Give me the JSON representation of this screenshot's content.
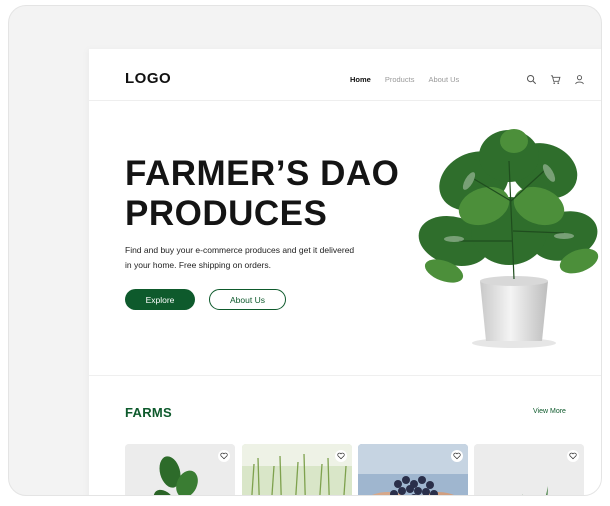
{
  "header": {
    "logo": "LOGO",
    "nav": [
      {
        "label": "Home",
        "active": true
      },
      {
        "label": "Products",
        "active": false
      },
      {
        "label": "About Us",
        "active": false
      }
    ],
    "icons": [
      "search-icon",
      "cart-icon",
      "user-icon"
    ]
  },
  "hero": {
    "title_line1": "FARMER’S DAO",
    "title_line2": "PRODUCES",
    "description": "Find and buy your e-commerce produces and get it delivered in your home. Free shipping on orders.",
    "primary_button": "Explore",
    "secondary_button": "About Us",
    "image": "potted-monstera-plant"
  },
  "farms": {
    "title": "FARMS",
    "view_more": "View More",
    "cards": [
      {
        "image": "plant-leaves",
        "icon": "heart-icon"
      },
      {
        "image": "wheat-field",
        "icon": "heart-icon"
      },
      {
        "image": "blueberries-in-hands",
        "icon": "heart-icon"
      },
      {
        "image": "succulent-plant",
        "icon": "heart-icon"
      }
    ]
  },
  "colors": {
    "brand_green": "#0e5a2c",
    "text_dark": "#141414",
    "background_grey": "#f3f3f3"
  }
}
